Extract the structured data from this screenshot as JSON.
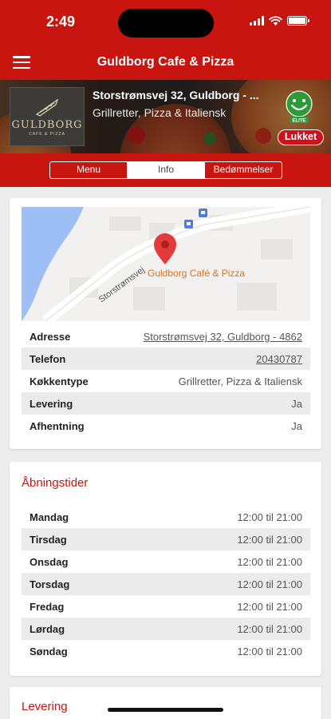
{
  "status_bar": {
    "time": "2:49"
  },
  "nav": {
    "title": "Guldborg Cafe & Pizza"
  },
  "hero": {
    "logo_name": "GULDBORG",
    "logo_sub": "CAFE & PIZZA",
    "address": "Storstrømsvej 32, Guldborg - ...",
    "cuisine": "Grillretter, Pizza & Italiensk",
    "smiley_label": "ELITE",
    "status_badge": "Lukket"
  },
  "tabs": [
    {
      "label": "Menu",
      "active": false
    },
    {
      "label": "Info",
      "active": true
    },
    {
      "label": "Bedømmelser",
      "active": false
    }
  ],
  "map": {
    "street_label": "Storstrømsvej",
    "place_label": "Guldborg Café & Pizza"
  },
  "info": {
    "rows": [
      {
        "label": "Adresse",
        "value": "Storstrømsvej 32, Guldborg - 4862"
      },
      {
        "label": "Telefon",
        "value": "20430787"
      },
      {
        "label": "Køkkentype",
        "value": "Grillretter, Pizza & Italiensk"
      },
      {
        "label": "Levering",
        "value": "Ja"
      },
      {
        "label": "Afhentning",
        "value": "Ja"
      }
    ]
  },
  "hours": {
    "title": "Åbningstider",
    "rows": [
      {
        "day": "Mandag",
        "time": "12:00 til 21:00"
      },
      {
        "day": "Tirsdag",
        "time": "12:00 til 21:00"
      },
      {
        "day": "Onsdag",
        "time": "12:00 til 21:00"
      },
      {
        "day": "Torsdag",
        "time": "12:00 til 21:00"
      },
      {
        "day": "Fredag",
        "time": "12:00 til 21:00"
      },
      {
        "day": "Lørdag",
        "time": "12:00 til 21:00"
      },
      {
        "day": "Søndag",
        "time": "12:00 til 21:00"
      }
    ]
  },
  "delivery": {
    "title": "Levering"
  },
  "colors": {
    "brand_red": "#c8150f",
    "badge_red": "#d0101a",
    "map_water": "#9ebff5",
    "pin_red": "#e33b3b",
    "place_label_orange": "#d4761c"
  },
  "icons": [
    "hamburger-menu-icon",
    "wifi-icon",
    "battery-icon",
    "map-pin-icon",
    "bus-stop-icon",
    "smiley-elite-icon",
    "pizza-slice-icon"
  ]
}
